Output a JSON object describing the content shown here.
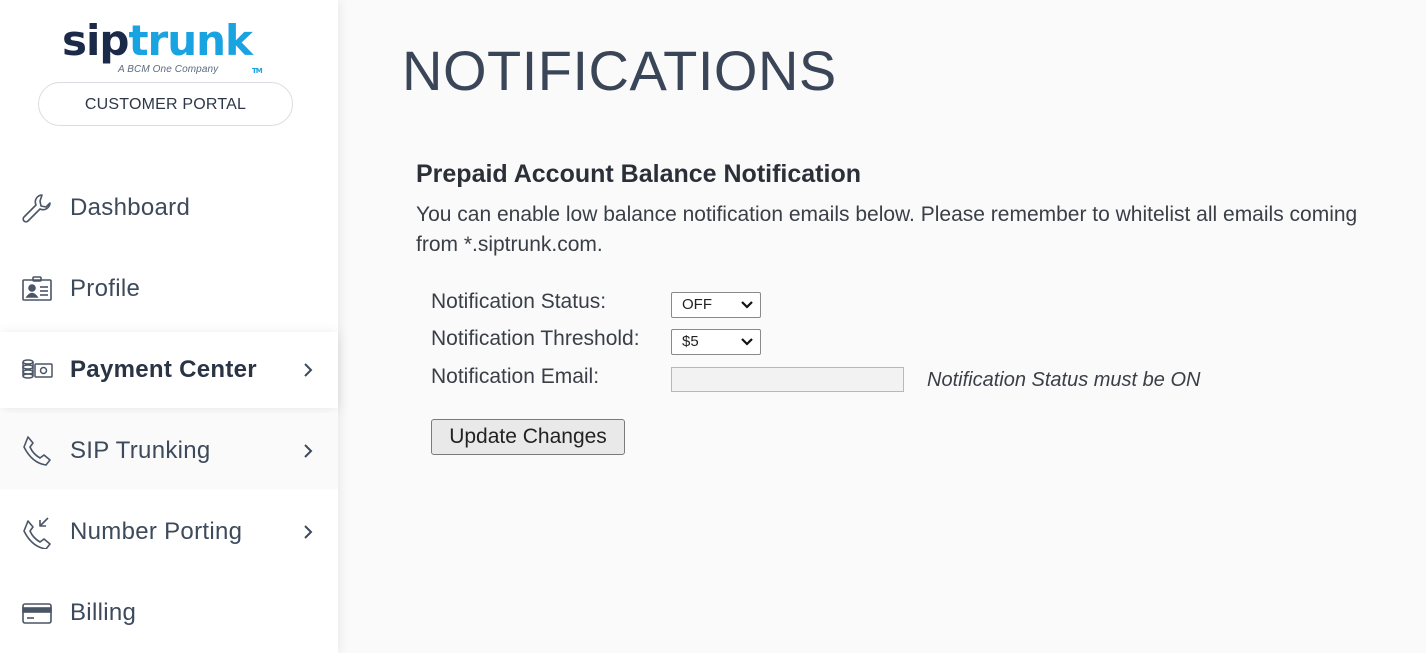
{
  "brand": {
    "logo_sip": "sip",
    "logo_trunk": "trunk",
    "logo_tm": "TM",
    "tagline": "A BCM One Company",
    "portal_label": "CUSTOMER PORTAL",
    "accent_color": "#1aa3e1",
    "dark_color": "#1c2a4a"
  },
  "sidebar": {
    "items": [
      {
        "label": "Dashboard",
        "icon": "wrench-icon",
        "has_chevron": false,
        "active": false
      },
      {
        "label": "Profile",
        "icon": "id-card-icon",
        "has_chevron": false,
        "active": false
      },
      {
        "label": "Payment Center",
        "icon": "coins-icon",
        "has_chevron": true,
        "active": true
      },
      {
        "label": "SIP Trunking",
        "icon": "phone-icon",
        "has_chevron": true,
        "active": false
      },
      {
        "label": "Number Porting",
        "icon": "phone-incoming-icon",
        "has_chevron": true,
        "active": false
      },
      {
        "label": "Billing",
        "icon": "credit-card-icon",
        "has_chevron": false,
        "active": false
      }
    ]
  },
  "main": {
    "title": "NOTIFICATIONS",
    "section": {
      "title": "Prepaid Account Balance Notification",
      "description": "You can enable low balance notification emails below. Please remember to whitelist all emails coming from *.siptrunk.com."
    },
    "form": {
      "status_label": "Notification Status:",
      "status_value": "OFF",
      "threshold_label": "Notification Threshold:",
      "threshold_value": "$5",
      "email_label": "Notification Email:",
      "email_value": "",
      "email_hint": "Notification Status must be ON",
      "submit_label": "Update Changes"
    }
  }
}
